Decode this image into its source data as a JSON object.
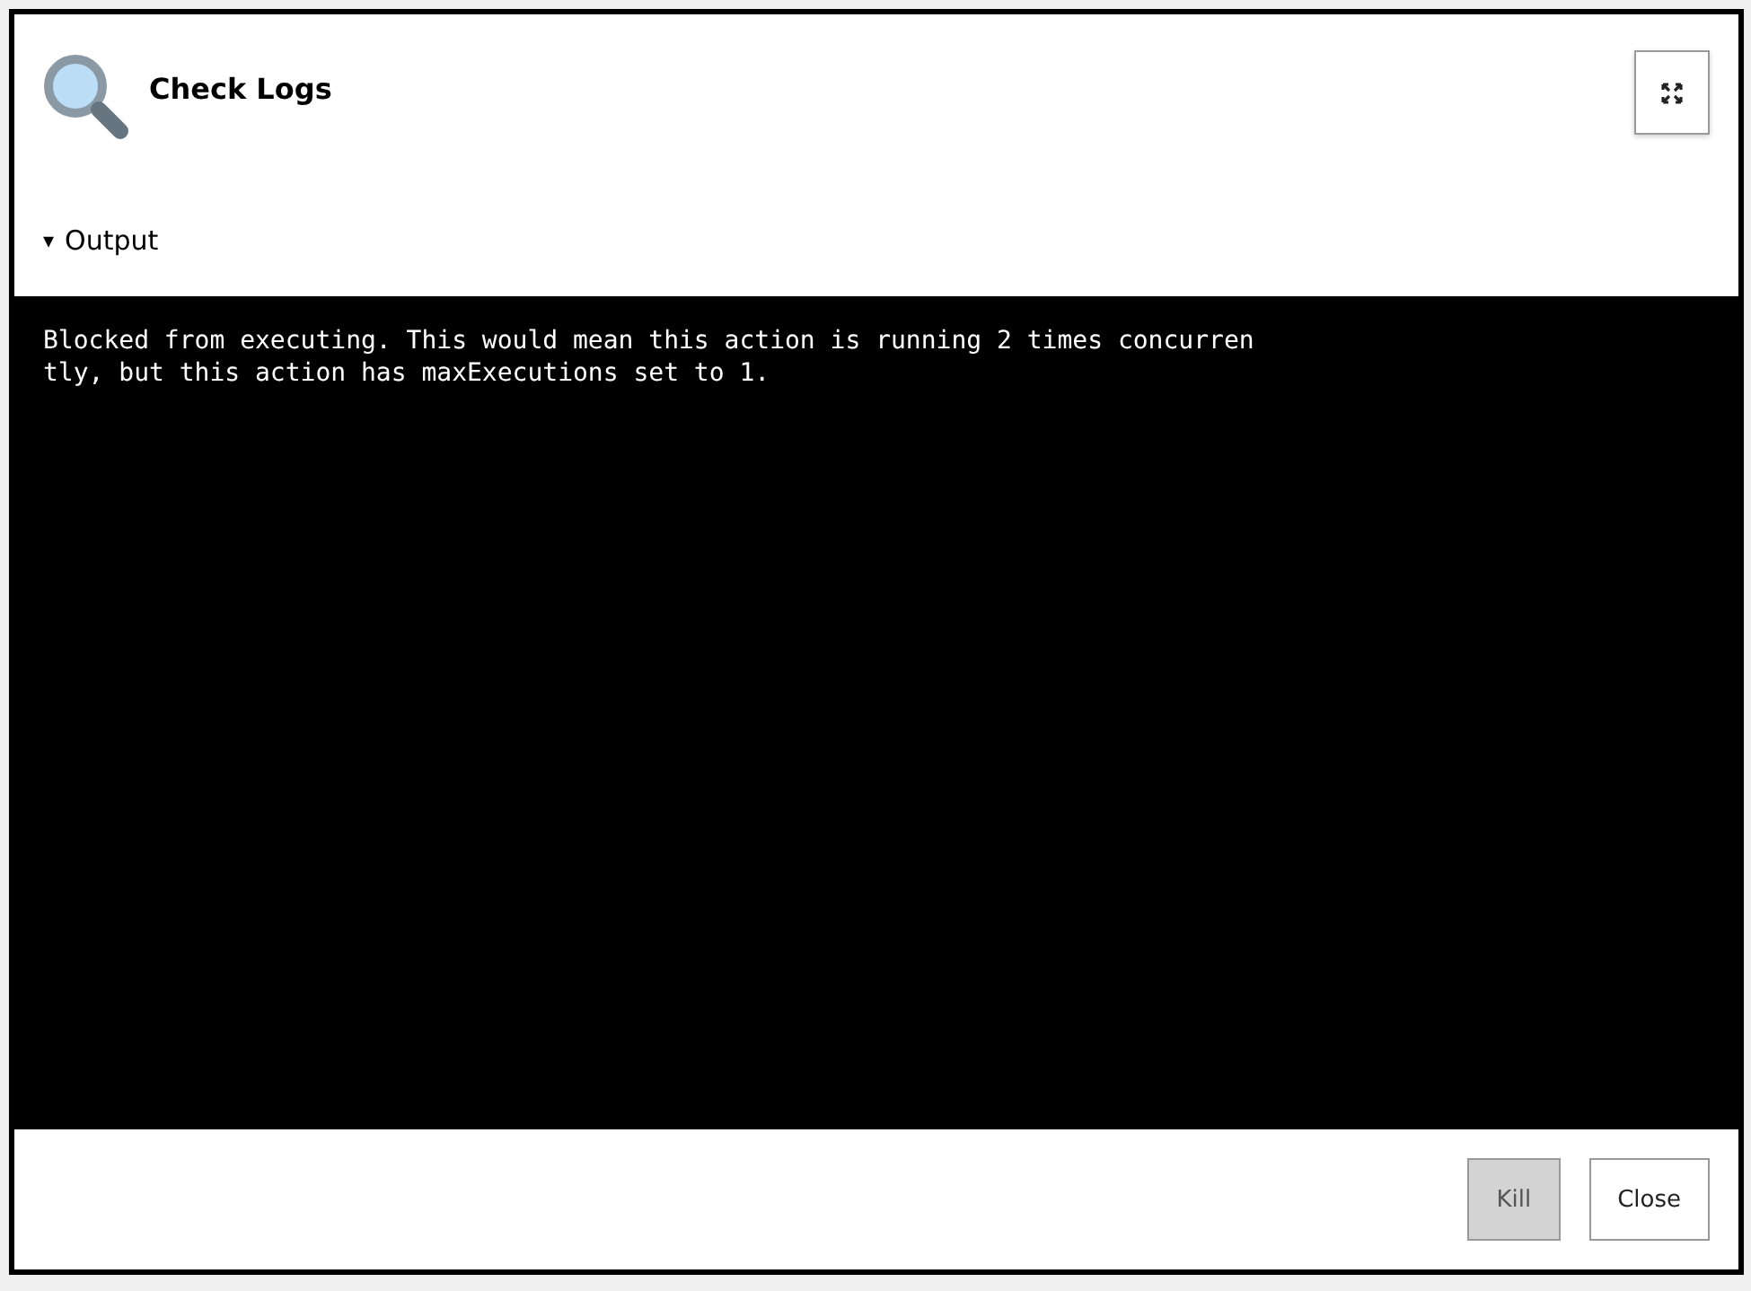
{
  "dialog": {
    "title": "Check Logs"
  },
  "output": {
    "toggle": "▾",
    "label": "Output",
    "expanded": true,
    "lines": [
      "Blocked from executing. This would mean this action is running 2 times concurren",
      "tly, but this action has maxExecutions set to 1."
    ]
  },
  "buttons": [
    {
      "label": "Kill",
      "disabled": true
    },
    {
      "label": "Close",
      "disabled": false
    }
  ]
}
